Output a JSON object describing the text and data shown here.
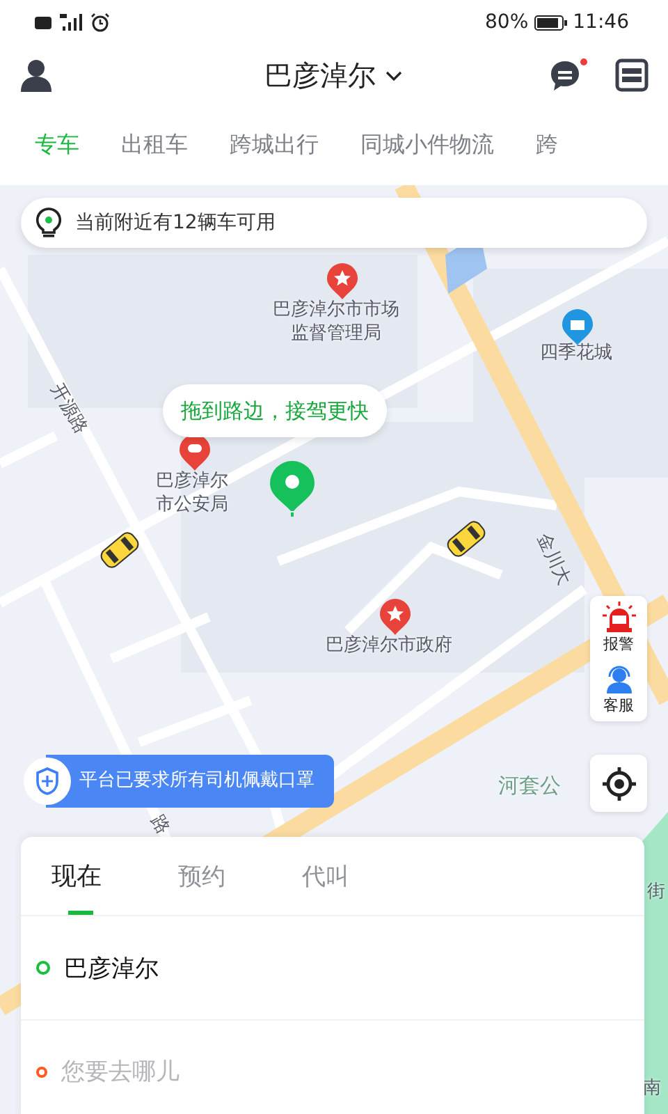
{
  "status_bar": {
    "battery": "80%",
    "time": "11:46"
  },
  "header": {
    "city": "巴彦淖尔",
    "messages_unread": true
  },
  "service_tabs": [
    {
      "label": "专车",
      "selected": true
    },
    {
      "label": "出租车",
      "selected": false
    },
    {
      "label": "跨城出行",
      "selected": false
    },
    {
      "label": "同城小件物流",
      "selected": false
    },
    {
      "label": "跨",
      "selected": false
    }
  ],
  "map": {
    "availability_banner": "当前附近有12辆车可用",
    "pickup_hint": "拖到路边，接驾更快",
    "labels": [
      {
        "text": "巴彦淖尔市市场监督管理局",
        "kind": "poi"
      },
      {
        "text": "四季花城",
        "kind": "building"
      },
      {
        "text": "开源路",
        "kind": "road"
      },
      {
        "text": "巴彦淖尔市公安局",
        "kind": "police"
      },
      {
        "text": "金川大",
        "kind": "road"
      },
      {
        "text": "巴彦淖尔市政府",
        "kind": "poi"
      },
      {
        "text": "河套公",
        "kind": "park"
      },
      {
        "text": "路",
        "kind": "road"
      },
      {
        "text": "街",
        "kind": "road"
      },
      {
        "text": "南",
        "kind": "road"
      }
    ],
    "safety_buttons": [
      {
        "label": "报警",
        "kind": "alarm"
      },
      {
        "label": "客服",
        "kind": "service"
      }
    ],
    "mask_notice": "平台已要求所有司机佩戴口罩"
  },
  "booking": {
    "tabs": [
      {
        "label": "现在",
        "selected": true
      },
      {
        "label": "预约",
        "selected": false
      },
      {
        "label": "代叫",
        "selected": false
      }
    ],
    "origin": {
      "value": "巴彦淖尔"
    },
    "destination": {
      "placeholder": "您要去哪儿"
    }
  }
}
